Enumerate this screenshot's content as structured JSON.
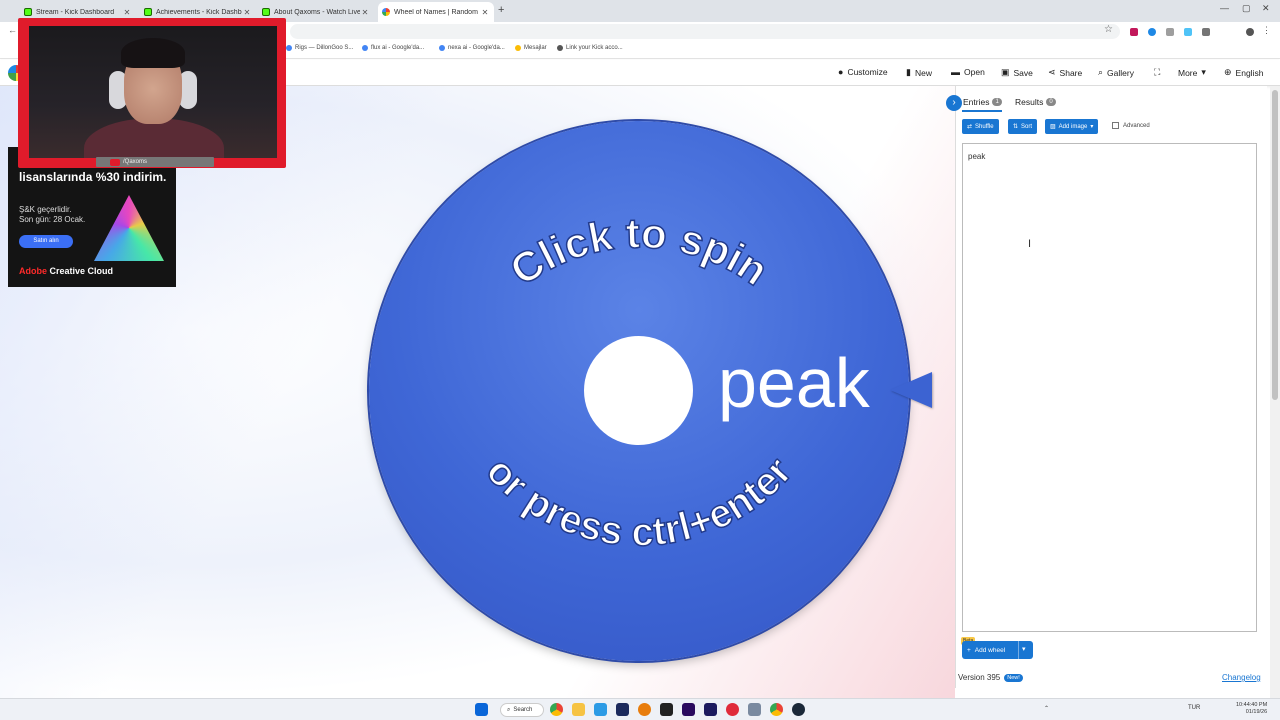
{
  "browser": {
    "tabs": [
      {
        "label": "Stream - Kick Dashboard",
        "icon": "kick-icon"
      },
      {
        "label": "Achievements - Kick Dashboard",
        "icon": "kick-icon"
      },
      {
        "label": "About Qaxoms - Watch Live o",
        "icon": "kick-icon"
      },
      {
        "label": "Wheel of Names | Random nam",
        "icon": "google-icon",
        "active": true
      }
    ],
    "new_tab": "+",
    "bookmarks": [
      "Rigs — DillonGoo S...",
      "flux ai - Google'da...",
      "nexa ai - Google'da...",
      "Mesajlar",
      "Link your Kick acco..."
    ]
  },
  "toolbar": {
    "customize": "Customize",
    "new": "New",
    "open": "Open",
    "save": "Save",
    "share": "Share",
    "gallery": "Gallery",
    "more": "More",
    "language": "English"
  },
  "wheel": {
    "top_text": "Click to spin",
    "bottom_text": "or press ctrl+enter",
    "entry": "peak",
    "color": "#3f67d6"
  },
  "panel": {
    "tabs": [
      {
        "label": "Entries",
        "count": "1"
      },
      {
        "label": "Results",
        "count": "0"
      }
    ],
    "shuffle": "Shuffle",
    "sort": "Sort",
    "add_image": "Add image",
    "advanced": "Advanced",
    "entries_text": "peak",
    "beta": "Beta",
    "add_wheel": "Add wheel",
    "version": "Version 395",
    "new_badge": "New!",
    "changelog": "Changelog"
  },
  "webcam": {
    "handle": "/Qaxoms"
  },
  "ad": {
    "headline": "lisanslarında %30 indirim.",
    "note_line1": "Ş&K geçerlidir.",
    "note_line2": "Son gün: 28 Ocak.",
    "button": "Satın alın",
    "brand_red": "Adobe",
    "brand_rest": " Creative Cloud"
  },
  "taskbar": {
    "search": "Search",
    "language": "TUR",
    "time": "10:44:40 PM",
    "date": "01/19/26"
  }
}
